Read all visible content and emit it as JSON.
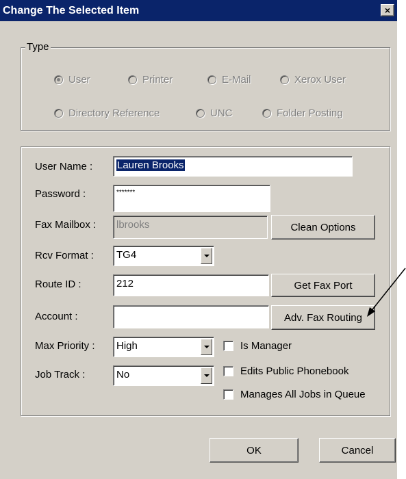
{
  "window": {
    "title": "Change The Selected Item",
    "close_label": "×"
  },
  "type_group": {
    "legend": "Type",
    "options": [
      {
        "label": "User",
        "checked": true
      },
      {
        "label": "Printer",
        "checked": false
      },
      {
        "label": "E-Mail",
        "checked": false
      },
      {
        "label": "Xerox User",
        "checked": false
      },
      {
        "label": "Directory Reference",
        "checked": false
      },
      {
        "label": "UNC",
        "checked": false
      },
      {
        "label": "Folder Posting",
        "checked": false
      }
    ]
  },
  "form": {
    "user_name": {
      "label": "User Name :",
      "value": "Lauren Brooks"
    },
    "password": {
      "label": "Password :",
      "value": "*******"
    },
    "fax_mailbox": {
      "label": "Fax Mailbox :",
      "value": "lbrooks"
    },
    "rcv_format": {
      "label": "Rcv Format :",
      "value": "TG4"
    },
    "route_id": {
      "label": "Route ID :",
      "value": "212"
    },
    "account": {
      "label": "Account :",
      "value": ""
    },
    "max_priority": {
      "label": "Max Priority :",
      "value": "High"
    },
    "job_track": {
      "label": "Job Track :",
      "value": "No"
    }
  },
  "buttons": {
    "clean_options": "Clean Options",
    "get_fax_port": "Get Fax Port",
    "adv_fax_routing": "Adv. Fax Routing",
    "ok": "OK",
    "cancel": "Cancel"
  },
  "checkboxes": {
    "is_manager": {
      "label": "Is Manager",
      "checked": false
    },
    "edits_public_phonebook": {
      "label": "Edits Public Phonebook",
      "checked": false
    },
    "manages_all_jobs": {
      "label": "Manages All Jobs in Queue",
      "checked": false
    }
  },
  "colors": {
    "titlebar": "#0a246a",
    "dialog_face": "#d4d0c8",
    "disabled_text": "#808080"
  }
}
